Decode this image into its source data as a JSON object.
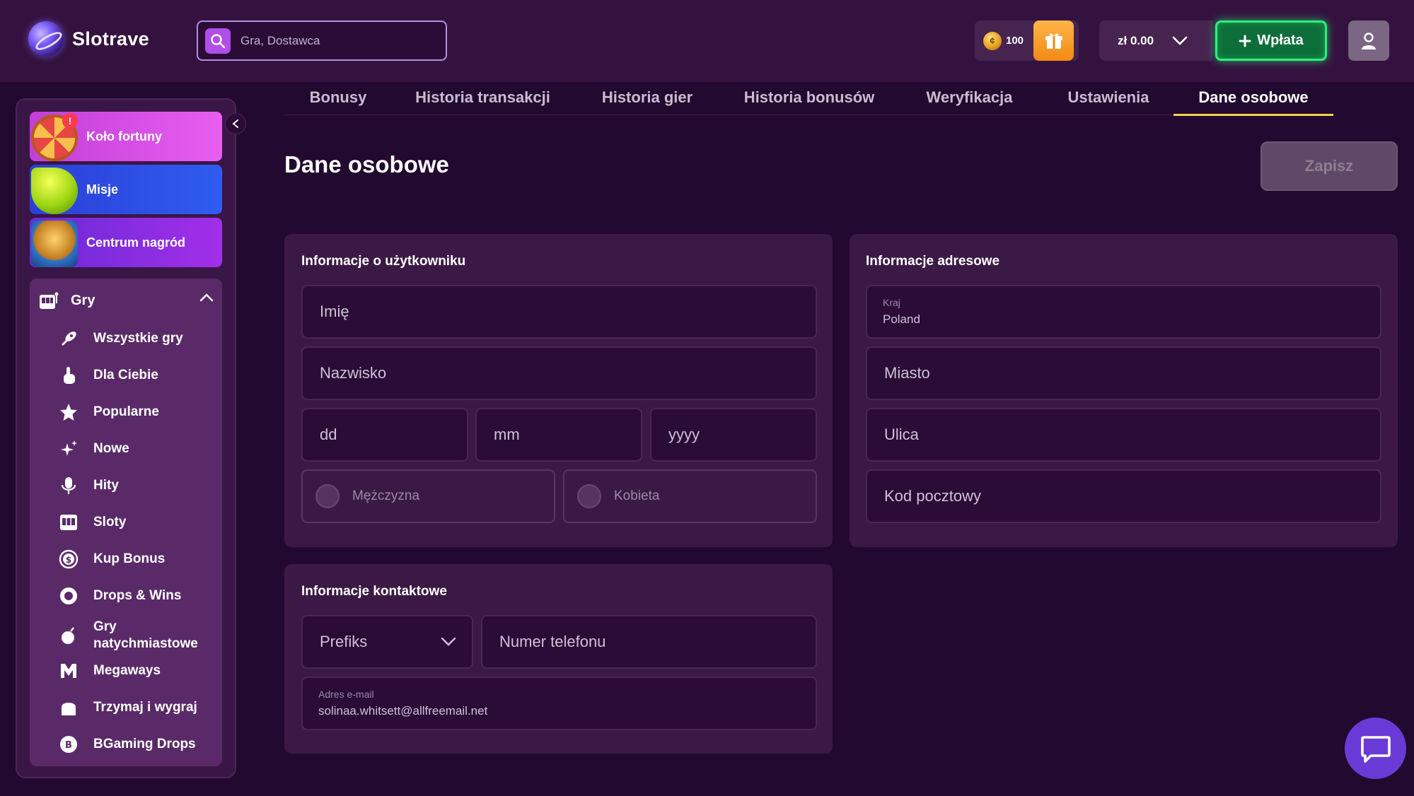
{
  "header": {
    "brand": "Slotrave",
    "search_placeholder": "Gra, Dostawca",
    "coins": "100",
    "balance": "zł 0.00",
    "deposit_label": "Wpłata"
  },
  "sidebar": {
    "promos": [
      {
        "label": "Koło fortuny",
        "badge": "!"
      },
      {
        "label": "Misje"
      },
      {
        "label": "Centrum nagród"
      }
    ],
    "games_label": "Gry",
    "items": [
      {
        "label": "Wszystkie gry"
      },
      {
        "label": "Dla Ciebie"
      },
      {
        "label": "Popularne"
      },
      {
        "label": "Nowe"
      },
      {
        "label": "Hity"
      },
      {
        "label": "Sloty"
      },
      {
        "label": "Kup Bonus"
      },
      {
        "label": "Drops & Wins"
      },
      {
        "label": "Gry natychmiastowe"
      },
      {
        "label": "Megaways"
      },
      {
        "label": "Trzymaj i wygraj"
      },
      {
        "label": "BGaming Drops"
      }
    ]
  },
  "tabs": [
    {
      "label": "Bonusy"
    },
    {
      "label": "Historia transakcji"
    },
    {
      "label": "Historia gier"
    },
    {
      "label": "Historia bonusów"
    },
    {
      "label": "Weryfikacja"
    },
    {
      "label": "Ustawienia"
    },
    {
      "label": "Dane osobowe",
      "active": true
    }
  ],
  "page": {
    "title": "Dane osobowe",
    "save_label": "Zapisz"
  },
  "user_info": {
    "title": "Informacje o użytkowniku",
    "first_name_placeholder": "Imię",
    "last_name_placeholder": "Nazwisko",
    "day_placeholder": "dd",
    "month_placeholder": "mm",
    "year_placeholder": "yyyy",
    "gender_male": "Mężczyzna",
    "gender_female": "Kobieta"
  },
  "contact_info": {
    "title": "Informacje kontaktowe",
    "prefix_placeholder": "Prefiks",
    "phone_placeholder": "Numer telefonu",
    "email_label": "Adres e-mail",
    "email_value": "solinaa.whitsett@allfreemail.net"
  },
  "address_info": {
    "title": "Informacje adresowe",
    "country_label": "Kraj",
    "country_value": "Poland",
    "city_placeholder": "Miasto",
    "street_placeholder": "Ulica",
    "postal_placeholder": "Kod pocztowy"
  },
  "colors": {
    "background": "#22092f",
    "topbar": "#34123f",
    "accent_tab": "#f5d34a",
    "deposit_green": "#2cf07a",
    "gift_orange": "#f28a12"
  }
}
